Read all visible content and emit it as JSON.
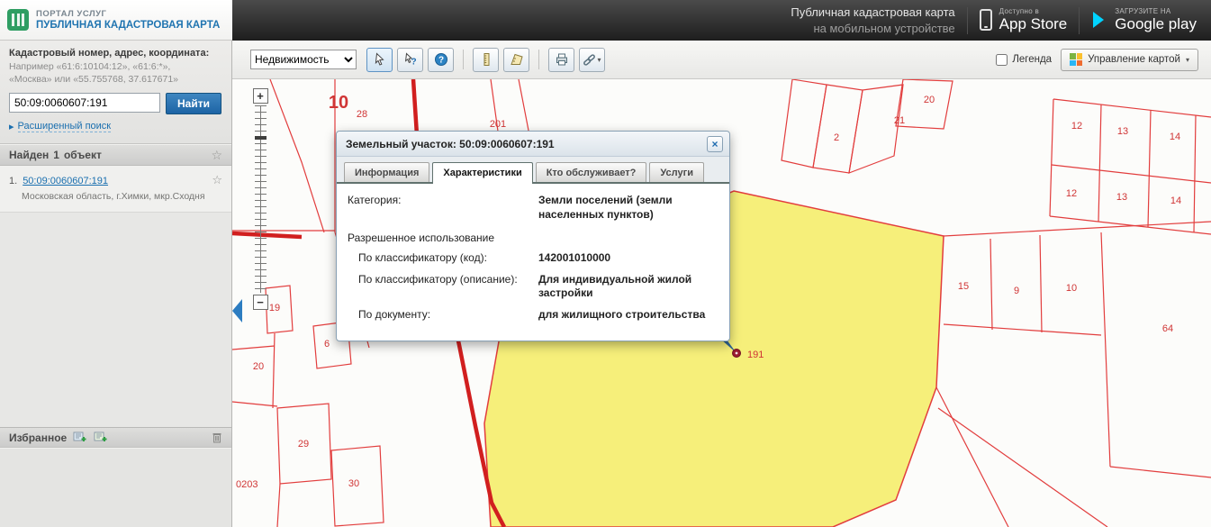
{
  "header": {
    "logo": {
      "line1": "ПОРТАЛ УСЛУГ",
      "line2": "ПУБЛИЧНАЯ КАДАСТРОВАЯ КАРТА"
    },
    "mobile": {
      "line1": "Публичная кадастровая карта",
      "line2": "на мобильном устройстве"
    },
    "appstore": {
      "small": "Доступно в",
      "big": "App Store"
    },
    "googleplay": {
      "small": "ЗАГРУЗИТЕ НА",
      "big": "Google play"
    }
  },
  "sidebar": {
    "search": {
      "label": "Кадастровый номер, адрес, координата:",
      "hint1": "Например «61:6:10104:12», «61:6:*»,",
      "hint2": "«Москва» или «55.755768, 37.617671»",
      "value": "50:09:0060607:191",
      "find": "Найти",
      "advanced": "Расширенный поиск"
    },
    "results": {
      "header_prefix": "Найден",
      "count": "1",
      "header_suffix": "объект",
      "item": {
        "index": "1.",
        "link": "50:09:0060607:191",
        "address": "Московская область, г.Химки, мкр.Сходня"
      }
    },
    "favorites": {
      "label": "Избранное"
    }
  },
  "toolbar": {
    "category": "Недвижимость",
    "legend": "Легенда",
    "manage": "Управление картой"
  },
  "icons": {
    "caret": "▾",
    "star": "☆",
    "arrow_right": "▸"
  },
  "zoom": {
    "plus": "+",
    "minus": "−"
  },
  "popup": {
    "title": "Земельный участок: 50:09:0060607:191",
    "close": "×",
    "tabs": [
      "Информация",
      "Характеристики",
      "Кто обслуживает?",
      "Услуги"
    ],
    "active_tab": "Характеристики",
    "fields": {
      "category_label": "Категория:",
      "category_value": "Земли поселений (земли населенных пунктов)",
      "section": "Разрешенное использование",
      "code_label": "По классификатору (код):",
      "code_value": "142001010000",
      "desc_label": "По классификатору (описание):",
      "desc_value": "Для индивидуальной жилой застройки",
      "doc_label": "По документу:",
      "doc_value": "для жилищного строительства"
    }
  },
  "map": {
    "labels": [
      "10",
      "28",
      "201",
      "2",
      "20",
      "21",
      "12",
      "13",
      "14",
      "12",
      "13",
      "14",
      "15",
      "9",
      "10",
      "64",
      "19",
      "6",
      "20",
      "29",
      "30",
      "0203",
      "191"
    ],
    "colors": {
      "parcel_line": "#e23d3d",
      "selected_fill": "#f6ef7a",
      "road": "#d11f1f",
      "marker": "#9b1b30"
    }
  }
}
